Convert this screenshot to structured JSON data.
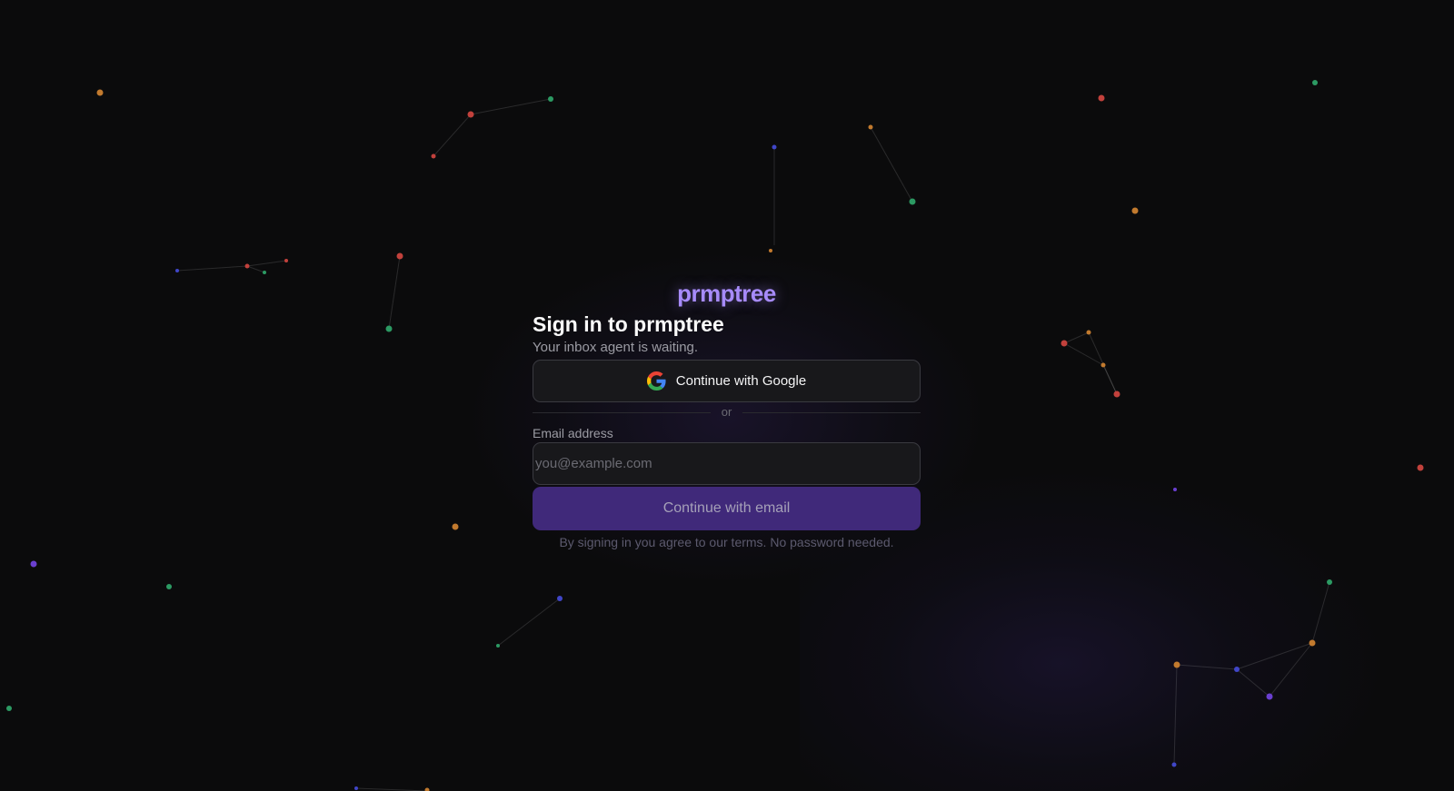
{
  "brand": {
    "name": "prmptree",
    "color": "#a78bfa"
  },
  "card": {
    "title": "Sign in to prmptree",
    "subtitle": "Your inbox agent is waiting.",
    "google_button": {
      "label": "Continue with Google",
      "icon": "google-g-icon"
    },
    "divider_text": "or",
    "email": {
      "label": "Email address",
      "value": "",
      "placeholder": "you@example.com"
    },
    "submit_label": "Continue with email",
    "terms": "By signing in you agree to our terms. No password needed."
  },
  "colors": {
    "background": "#0b0b0c",
    "accent": "#40297a",
    "node_colors": [
      "#c2413c",
      "#c27a2e",
      "#2c9a63",
      "#4046c8",
      "#6a3fd0"
    ]
  }
}
